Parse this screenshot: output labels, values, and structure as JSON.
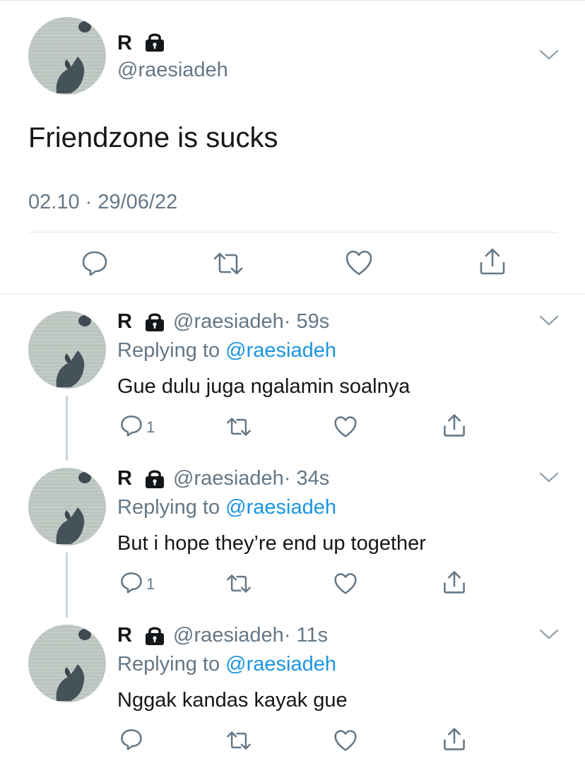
{
  "main_tweet": {
    "display_name": "R",
    "handle": "@raesiadeh",
    "text": "Friendzone is sucks",
    "timestamp": "02.10 · 29/06/22"
  },
  "replies": [
    {
      "display_name": "R",
      "handle": "@raesiadeh",
      "time": "· 59s",
      "replying_prefix": "Replying to ",
      "replying_to": "@raesiadeh",
      "text": "Gue dulu juga ngalamin soalnya",
      "reply_count": "1"
    },
    {
      "display_name": "R",
      "handle": "@raesiadeh",
      "time": "· 34s",
      "replying_prefix": "Replying to ",
      "replying_to": "@raesiadeh",
      "text": "But i hope they’re end up together",
      "reply_count": "1"
    },
    {
      "display_name": "R",
      "handle": "@raesiadeh",
      "time": "· 11s",
      "replying_prefix": "Replying to ",
      "replying_to": "@raesiadeh",
      "text": "Nggak kandas kayak gue",
      "reply_count": ""
    }
  ],
  "icons": {
    "reply": "reply-icon",
    "retweet": "retweet-icon",
    "like": "like-icon",
    "share": "share-icon",
    "lock": "lock-icon",
    "chevron": "chevron-down-icon"
  },
  "colors": {
    "text": "#14171a",
    "secondary": "#657786",
    "link": "#1b95e0",
    "divider": "#e1e8ed",
    "thread_line": "#ccd6dd"
  }
}
